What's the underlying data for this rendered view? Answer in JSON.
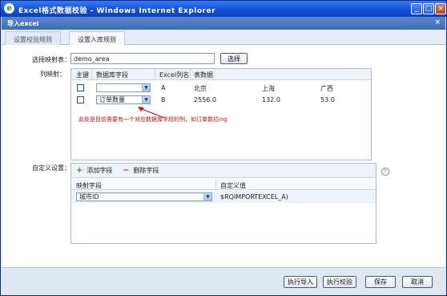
{
  "window": {
    "title": "Excel格式数据校验 - Windows Internet Explorer",
    "icon": "ie-icon"
  },
  "dialog": {
    "title": "导入excel",
    "close": "×"
  },
  "tabs": [
    {
      "label": "设置校验规则"
    },
    {
      "label": "设置入库规则"
    }
  ],
  "mapping_table": {
    "label": "选择映射表：",
    "value": "demo_area",
    "select_button": "选择"
  },
  "columns": {
    "label": "列映射：",
    "headers": [
      "主键",
      "数据库字段",
      "Excel列名",
      "表数据"
    ],
    "rows": [
      {
        "db_field": "",
        "excel_col": "A",
        "values": [
          "北京",
          "上海",
          "广西"
        ]
      },
      {
        "db_field": "订单数量",
        "excel_col": "B",
        "values": [
          "2556.0",
          "132.0",
          "53.0"
        ]
      }
    ],
    "note": "此处是目前需要有一个对应数据库字段的列，如订单数拉ing"
  },
  "custom": {
    "label": "自定义设置：",
    "add_label": "添加字段",
    "delete_label": "删除字段",
    "headers": [
      "映射字段",
      "自定义值"
    ],
    "row": {
      "field": "城市ID",
      "value": "$RQIMPORTEXCEL_A)"
    }
  },
  "buttons": {
    "import": "执行导入",
    "validate": "执行校验",
    "save": "保存",
    "cancel": "取消"
  },
  "help": "?"
}
